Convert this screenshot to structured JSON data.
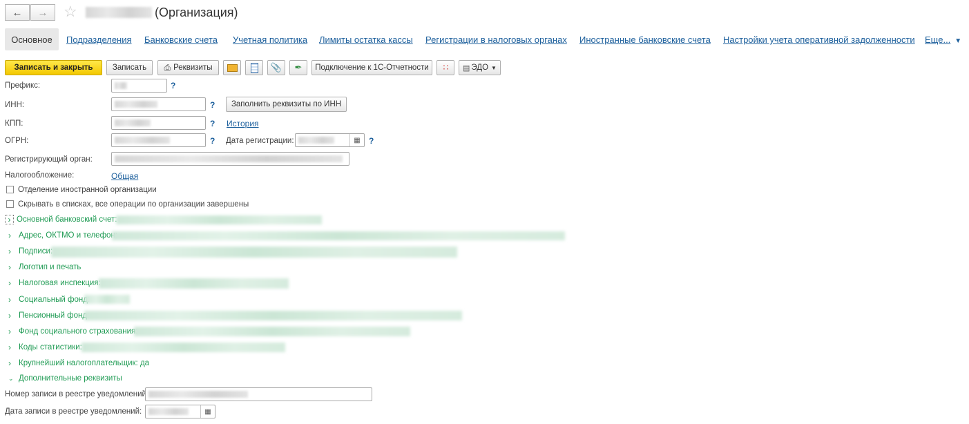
{
  "window": {
    "title": "(Организация)"
  },
  "tabs": [
    {
      "label": "Основное",
      "active": true
    },
    {
      "label": "Подразделения"
    },
    {
      "label": "Банковские счета"
    },
    {
      "label": "Учетная политика"
    },
    {
      "label": "Лимиты остатка кассы"
    },
    {
      "label": "Регистрации в налоговых органах"
    },
    {
      "label": "Иностранные банковские счета"
    },
    {
      "label": "Настройки учета оперативной задолженности"
    },
    {
      "label": "Еще..."
    }
  ],
  "toolbar": {
    "save_close": "Записать и закрыть",
    "save": "Записать",
    "requisites": "Реквизиты",
    "connect": "Подключение к 1С-Отчетности",
    "edo": "ЭДО"
  },
  "form": {
    "prefix_label": "Префикс:",
    "inn_label": "ИНН:",
    "kpp_label": "КПП:",
    "ogrn_label": "ОГРН:",
    "reg_date_label": "Дата регистрации:",
    "reg_organ_label": "Регистрирующий орган:",
    "taxation_label": "Налогообложение:",
    "taxation_value": "Общая",
    "fill_by_inn": "Заполнить реквизиты по ИНН",
    "history": "История",
    "help": "?",
    "foreign_branch": "Отделение иностранной организации",
    "hide_in_lists": "Скрывать в списках, все операции по организации завершены",
    "notice_number_label": "Номер записи в реестре уведомлений:",
    "notice_date_label": "Дата записи в реестре уведомлений:"
  },
  "groups": [
    {
      "label": "Основной банковский счет:",
      "expanded": false
    },
    {
      "label": "Адрес, ОКТМО и телефон:",
      "expanded": false
    },
    {
      "label": "Подписи:",
      "expanded": false
    },
    {
      "label": "Логотип и печать",
      "expanded": false
    },
    {
      "label": "Налоговая инспекция:",
      "expanded": false
    },
    {
      "label": "Социальный фонд:",
      "expanded": false
    },
    {
      "label": "Пенсионный фонд:",
      "expanded": false
    },
    {
      "label": "Фонд социального страхования:",
      "expanded": false
    },
    {
      "label": "Коды статистики:",
      "expanded": false
    },
    {
      "label": "Крупнейший налогоплательщик: да",
      "expanded": false
    },
    {
      "label": "Дополнительные реквизиты",
      "expanded": true
    }
  ],
  "colors": {
    "accent": "#1c5f9c",
    "group": "#1d9a52",
    "primary": "#f3c800"
  }
}
